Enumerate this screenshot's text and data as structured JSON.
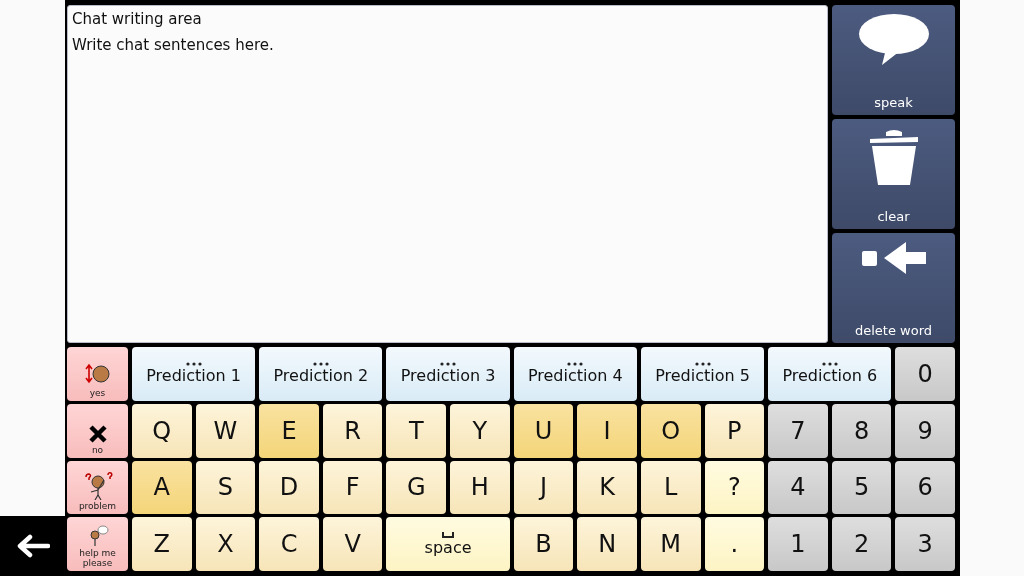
{
  "chat_area": {
    "title": "Chat writing area",
    "text": "Write chat sentences here."
  },
  "actions": [
    {
      "kind": "speak",
      "label": "speak"
    },
    {
      "kind": "clear",
      "label": "clear"
    },
    {
      "kind": "delete",
      "label": "delete word"
    }
  ],
  "quick_replies": [
    {
      "kind": "yes",
      "label": "yes"
    },
    {
      "kind": "no",
      "label": "no"
    },
    {
      "kind": "problem",
      "label": "problem"
    },
    {
      "kind": "help",
      "label": "help me please"
    }
  ],
  "key_rows": [
    [
      {
        "kind": "prediction",
        "label": "Prediction 1"
      },
      {
        "kind": "prediction",
        "label": "Prediction 2"
      },
      {
        "kind": "prediction",
        "label": "Prediction 3"
      },
      {
        "kind": "prediction",
        "label": "Prediction 4"
      },
      {
        "kind": "prediction",
        "label": "Prediction 5"
      },
      {
        "kind": "prediction",
        "label": "Prediction 6"
      },
      {
        "kind": "number",
        "label": "0"
      }
    ],
    [
      {
        "kind": "letter",
        "label": "Q"
      },
      {
        "kind": "letter",
        "label": "W"
      },
      {
        "kind": "vowel",
        "label": "E"
      },
      {
        "kind": "letter",
        "label": "R"
      },
      {
        "kind": "letter",
        "label": "T"
      },
      {
        "kind": "letter",
        "label": "Y"
      },
      {
        "kind": "vowel",
        "label": "U"
      },
      {
        "kind": "vowel",
        "label": "I"
      },
      {
        "kind": "vowel",
        "label": "O"
      },
      {
        "kind": "letter",
        "label": "P"
      },
      {
        "kind": "number",
        "label": "7"
      },
      {
        "kind": "number",
        "label": "8"
      },
      {
        "kind": "number",
        "label": "9"
      }
    ],
    [
      {
        "kind": "vowel",
        "label": "A"
      },
      {
        "kind": "letter",
        "label": "S"
      },
      {
        "kind": "letter",
        "label": "D"
      },
      {
        "kind": "letter",
        "label": "F"
      },
      {
        "kind": "letter",
        "label": "G"
      },
      {
        "kind": "letter",
        "label": "H"
      },
      {
        "kind": "letter",
        "label": "J"
      },
      {
        "kind": "letter",
        "label": "K"
      },
      {
        "kind": "letter",
        "label": "L"
      },
      {
        "kind": "punctuation",
        "label": "?"
      },
      {
        "kind": "number",
        "label": "4"
      },
      {
        "kind": "number",
        "label": "5"
      },
      {
        "kind": "number",
        "label": "6"
      }
    ],
    [
      {
        "kind": "letter",
        "label": "Z"
      },
      {
        "kind": "letter",
        "label": "X"
      },
      {
        "kind": "letter",
        "label": "C"
      },
      {
        "kind": "letter",
        "label": "V"
      },
      {
        "kind": "space",
        "label": "space"
      },
      {
        "kind": "letter",
        "label": "B"
      },
      {
        "kind": "letter",
        "label": "N"
      },
      {
        "kind": "letter",
        "label": "M"
      },
      {
        "kind": "punctuation",
        "label": "."
      },
      {
        "kind": "number",
        "label": "1"
      },
      {
        "kind": "number",
        "label": "2"
      },
      {
        "kind": "number",
        "label": "3"
      }
    ]
  ]
}
